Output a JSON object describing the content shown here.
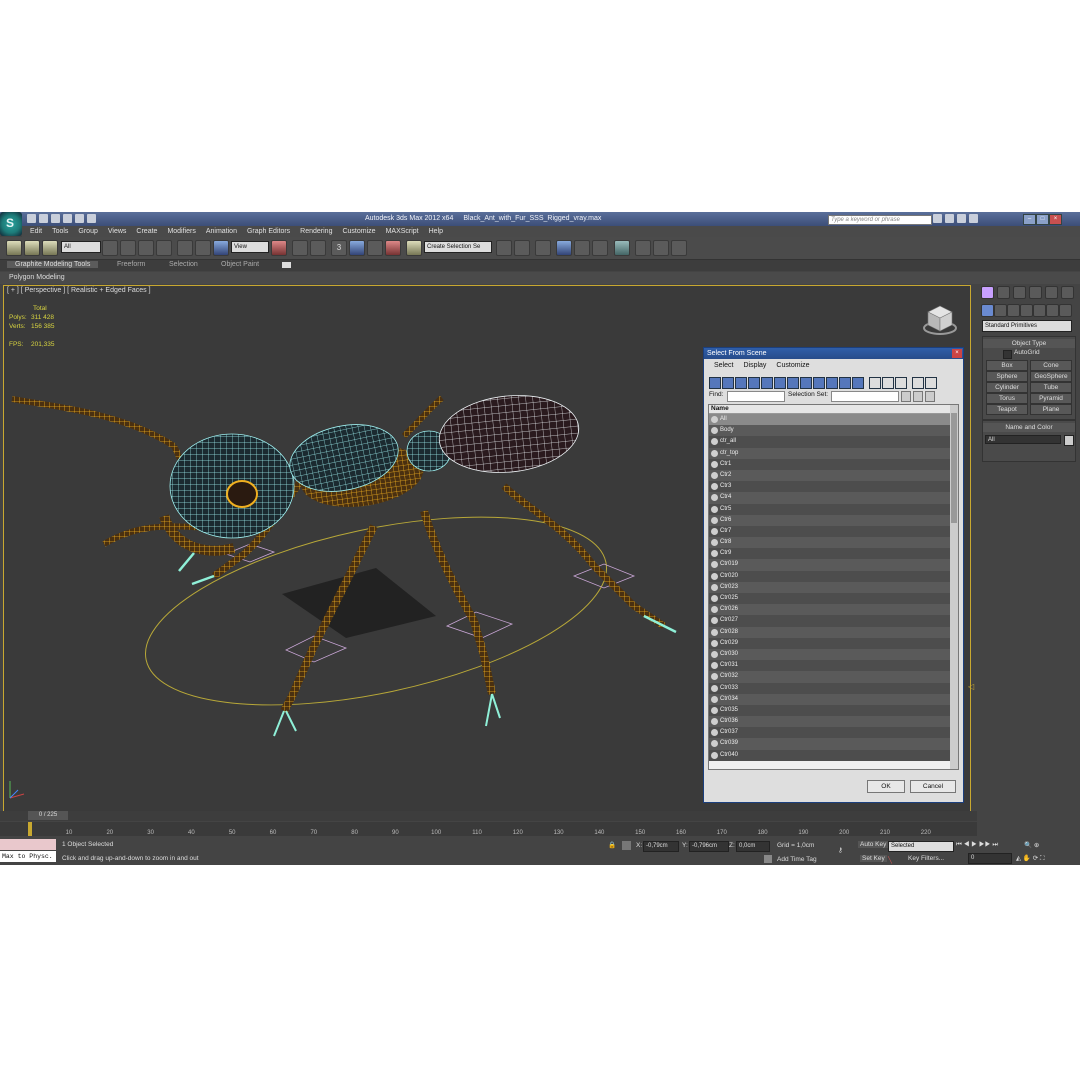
{
  "window": {
    "app_title": "Autodesk 3ds Max  2012 x64",
    "file_name": "Black_Ant_with_Fur_SSS_Rigged_vray.max",
    "search_placeholder": "Type a keyword or phrase",
    "logo_letter": "S"
  },
  "menu": [
    "Edit",
    "Tools",
    "Group",
    "Views",
    "Create",
    "Modifiers",
    "Animation",
    "Graph Editors",
    "Rendering",
    "Customize",
    "MAXScript",
    "Help"
  ],
  "toolbar": {
    "selection_filter": "All",
    "ref_coord": "View",
    "named_selection": "Create Selection Se",
    "snap_label": "3"
  },
  "ribbon": {
    "tabs": [
      "Graphite Modeling Tools",
      "Freeform",
      "Selection",
      "Object Paint"
    ],
    "active_tab": "Graphite Modeling Tools",
    "sub_label": "Polygon Modeling"
  },
  "viewport": {
    "label": "[ + ] [ Perspective ] [ Realistic + Edged Faces ]",
    "stats": {
      "total_label": "Total",
      "polys_label": "Polys:",
      "polys_value": "311 428",
      "verts_label": "Verts:",
      "verts_value": "156 385",
      "fps_label": "FPS:",
      "fps_value": "201,335"
    }
  },
  "command_panel": {
    "category": "Standard Primitives",
    "object_type_header": "Object Type",
    "autogrid_label": "AutoGrid",
    "buttons": [
      "Box",
      "Cone",
      "Sphere",
      "GeoSphere",
      "Cylinder",
      "Tube",
      "Torus",
      "Pyramid",
      "Teapot",
      "Plane"
    ],
    "name_color_header": "Name and Color",
    "name_value": "All"
  },
  "dialog": {
    "title": "Select From Scene",
    "menu": [
      "Select",
      "Display",
      "Customize"
    ],
    "find_label": "Find:",
    "selection_set_label": "Selection Set:",
    "column_name": "Name",
    "items": [
      "All",
      "Body",
      "ctr_all",
      "ctr_top",
      "Ctr1",
      "Ctr2",
      "Ctr3",
      "Ctr4",
      "Ctr5",
      "Ctr6",
      "Ctr7",
      "Ctr8",
      "Ctr9",
      "Ctr019",
      "Ctr020",
      "Ctr023",
      "Ctr025",
      "Ctr026",
      "Ctr027",
      "Ctr028",
      "Ctr029",
      "Ctr030",
      "Ctr031",
      "Ctr032",
      "Ctr033",
      "Ctr034",
      "Ctr035",
      "Ctr036",
      "Ctr037",
      "Ctr039",
      "Ctr040"
    ],
    "ok_label": "OK",
    "cancel_label": "Cancel"
  },
  "timeline": {
    "slider_label": "0 / 225",
    "ticks": [
      "10",
      "20",
      "30",
      "40",
      "50",
      "60",
      "70",
      "80",
      "90",
      "100",
      "110",
      "120",
      "130",
      "140",
      "150",
      "160",
      "170",
      "180",
      "190",
      "200",
      "210",
      "220"
    ]
  },
  "status": {
    "maxscript_label": "Max to Physc.",
    "selection_status": "1 Object Selected",
    "prompt": "Click and drag up-and-down to zoom in and out",
    "x_label": "X:",
    "x_value": "-0,79cm",
    "y_label": "Y:",
    "y_value": "-0,796cm",
    "z_label": "Z:",
    "z_value": "0,0cm",
    "grid": "Grid = 1,0cm",
    "add_time_tag": "Add Time Tag",
    "auto_key": "Auto Key",
    "set_key": "Set Key",
    "key_mode": "Selected",
    "key_filters": "Key Filters...",
    "frame_value": "0"
  }
}
